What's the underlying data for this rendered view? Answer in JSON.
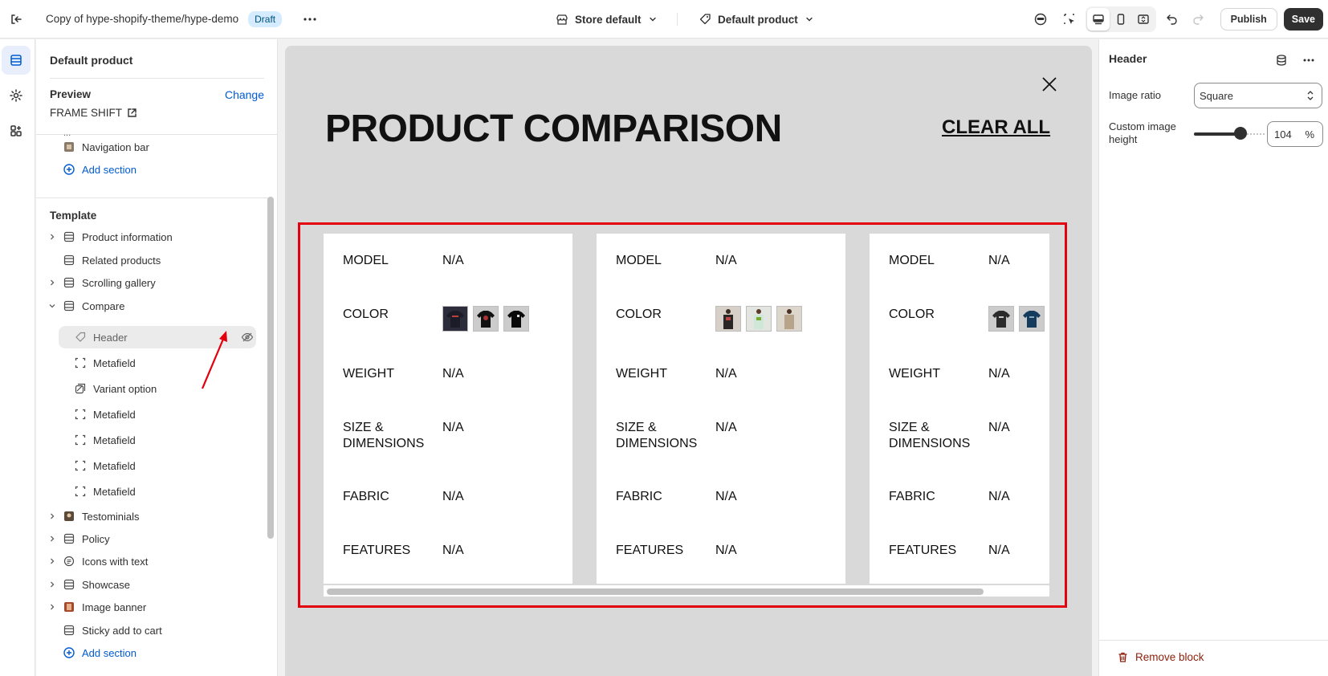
{
  "topbar": {
    "theme_name": "Copy of hype-shopify-theme/hype-demo",
    "status_badge": "Draft",
    "store_dropdown": "Store default",
    "template_dropdown": "Default product",
    "publish_label": "Publish",
    "save_label": "Save"
  },
  "sidebar": {
    "title": "Default product",
    "preview_label": "Preview",
    "change_label": "Change",
    "preview_value": "FRAME SHIFT",
    "header_items": [
      {
        "label": "Navigation bar"
      }
    ],
    "add_section_label": "Add section",
    "template_label": "Template",
    "template_items": [
      {
        "label": "Product information",
        "expandable": true
      },
      {
        "label": "Related products",
        "expandable": false
      },
      {
        "label": "Scrolling gallery",
        "expandable": true
      },
      {
        "label": "Compare",
        "expandable": true,
        "expanded": true
      },
      {
        "label": "Header",
        "block": true,
        "selected": true
      },
      {
        "label": "Metafield",
        "block": true
      },
      {
        "label": "Variant option",
        "block": true
      },
      {
        "label": "Metafield",
        "block": true
      },
      {
        "label": "Metafield",
        "block": true
      },
      {
        "label": "Metafield",
        "block": true
      },
      {
        "label": "Metafield",
        "block": true
      },
      {
        "label": "Testominials",
        "expandable": true
      },
      {
        "label": "Policy",
        "expandable": true
      },
      {
        "label": "Icons with text",
        "expandable": true
      },
      {
        "label": "Showcase",
        "expandable": true
      },
      {
        "label": "Image banner",
        "expandable": true
      },
      {
        "label": "Sticky add to cart",
        "expandable": false
      }
    ],
    "add_section_bottom": "Add section"
  },
  "preview": {
    "title": "PRODUCT COMPARISON",
    "clear_all": "CLEAR ALL",
    "cards": [
      {
        "rows": [
          {
            "key": "MODEL",
            "value": "N/A"
          },
          {
            "key": "COLOR",
            "value": ""
          },
          {
            "key": "WEIGHT",
            "value": "N/A"
          },
          {
            "key": "SIZE & DIMENSIONS",
            "value": "N/A"
          },
          {
            "key": "FABRIC",
            "value": "N/A"
          },
          {
            "key": "FEATURES",
            "value": "N/A"
          }
        ],
        "swatches": [
          "#2c2c3a",
          "#1a1a1a",
          "#111111"
        ]
      },
      {
        "rows": [
          {
            "key": "MODEL",
            "value": "N/A"
          },
          {
            "key": "COLOR",
            "value": ""
          },
          {
            "key": "WEIGHT",
            "value": "N/A"
          },
          {
            "key": "SIZE & DIMENSIONS",
            "value": "N/A"
          },
          {
            "key": "FABRIC",
            "value": "N/A"
          },
          {
            "key": "FEATURES",
            "value": "N/A"
          }
        ],
        "swatches": [
          "#3a3030",
          "#cfe3d4",
          "#b8a48a"
        ]
      },
      {
        "rows": [
          {
            "key": "MODEL",
            "value": "N/A"
          },
          {
            "key": "COLOR",
            "value": ""
          },
          {
            "key": "WEIGHT",
            "value": "N/A"
          },
          {
            "key": "SIZE & DIMENSIONS",
            "value": "N/A"
          },
          {
            "key": "FABRIC",
            "value": "N/A"
          },
          {
            "key": "FEATURES",
            "value": "N/A"
          }
        ],
        "swatches": [
          "#2b2b2b",
          "#153c5c"
        ]
      }
    ]
  },
  "settings": {
    "title": "Header",
    "image_ratio_label": "Image ratio",
    "image_ratio_value": "Square",
    "custom_height_label_1": "Custom image",
    "custom_height_label_2": "height",
    "custom_height_value": "104",
    "custom_height_unit": "%",
    "custom_height_slider_fraction": 0.65,
    "remove_block_label": "Remove block"
  },
  "colors": {
    "accent_link": "#005bd3",
    "annotation_red": "#e3000f",
    "danger": "#8e1f0b",
    "save_bg": "#303030"
  }
}
